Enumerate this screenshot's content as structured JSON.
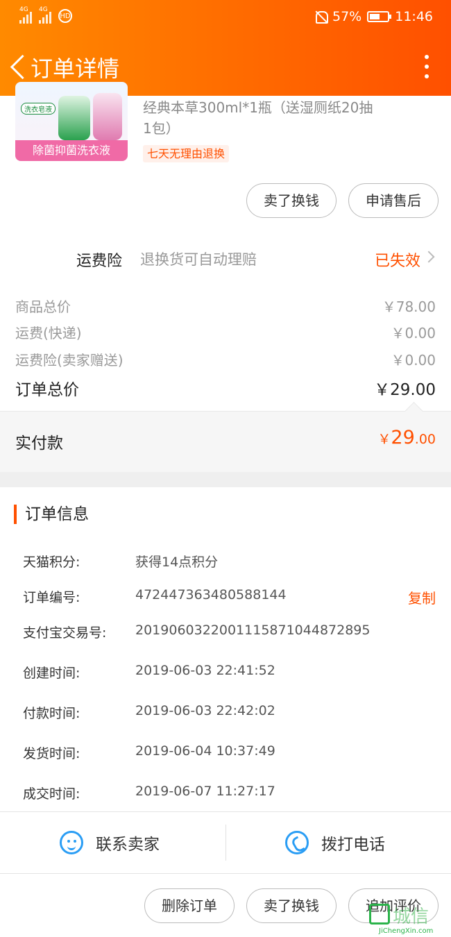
{
  "status_bar": {
    "network_1": "4G",
    "network_2": "4G",
    "hd": "HD",
    "battery": "57%",
    "battery_level": 0.57,
    "time": "11:46"
  },
  "header": {
    "title": "订单详情"
  },
  "product": {
    "image_caption": "除菌抑菌洗衣液",
    "image_brand": "洗衣皂液",
    "title": "经典本草300ml*1瓶（送湿厕纸20抽1包）",
    "tag": "七天无理由退换",
    "actions": [
      "卖了换钱",
      "申请售后"
    ]
  },
  "insurance": {
    "name": "运费险",
    "desc": "退换货可自动理赔",
    "status": "已失效"
  },
  "price": {
    "rows": [
      {
        "label": "商品总价",
        "value": "￥78.00"
      },
      {
        "label": "运费(快递)",
        "value": "￥0.00"
      },
      {
        "label": "运费险(卖家赠送)",
        "value": "￥0.00"
      }
    ],
    "total_label": "订单总价",
    "total_value": "￥29.00",
    "paid_label": "实付款",
    "paid_currency": "￥",
    "paid_int": "29",
    "paid_dec": ".00"
  },
  "order_info": {
    "title": "订单信息",
    "rows": [
      {
        "label": "天猫积分:",
        "value": "获得14点积分"
      },
      {
        "label": "订单编号:",
        "value": "472447363480588144",
        "action": "复制"
      },
      {
        "label": "支付宝交易号:",
        "value": "2019060322001115871044872895"
      },
      {
        "label": "创建时间:",
        "value": "2019-06-03 22:41:52"
      },
      {
        "label": "付款时间:",
        "value": "2019-06-03 22:42:02"
      },
      {
        "label": "发货时间:",
        "value": "2019-06-04 10:37:49"
      },
      {
        "label": "成交时间:",
        "value": "2019-06-07 11:27:17"
      }
    ]
  },
  "contact": {
    "seller": "联系卖家",
    "phone": "拨打电话"
  },
  "bottom_actions": [
    "删除订单",
    "卖了换钱",
    "追加评价"
  ],
  "watermark": {
    "text": "城信",
    "sub": "JiChengXin.com"
  }
}
